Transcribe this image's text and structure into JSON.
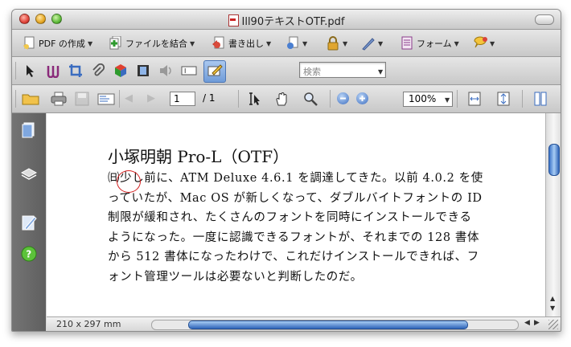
{
  "window": {
    "title": "Ill90テキストOTF.pdf",
    "colors": {
      "accent": "#2f64b8",
      "annotation": "#d42020"
    }
  },
  "toolbar1": {
    "create_pdf": "PDF の作成",
    "combine_files": "ファイルを結合",
    "export": "書き出し",
    "forms": "フォーム"
  },
  "toolbar2": {
    "search_placeholder": "検索"
  },
  "toolbar3": {
    "page_current": "1",
    "page_total": "/ 1",
    "zoom": "100%"
  },
  "document": {
    "heading": "小塚明朝 Pro-L（OTF）",
    "lines": [
      "㈰少し前に、ATM Deluxe 4.6.1 を調達してきた。以前 4.0.2 を使",
      "っていたが、Mac  OS が新しくなって、ダブルバイトフォントの ID",
      "制限が緩和され、たくさんのフォントを同時にインストールできる",
      "ようになった。一度に認識できるフォントが、それまでの 128 書体",
      "から 512 書体になったわけで、これだけインストールできれば、フ",
      "ォント管理ツールは必要ないと判断したのだ。"
    ]
  },
  "statusbar": {
    "page_size": "210 x 297 mm"
  }
}
